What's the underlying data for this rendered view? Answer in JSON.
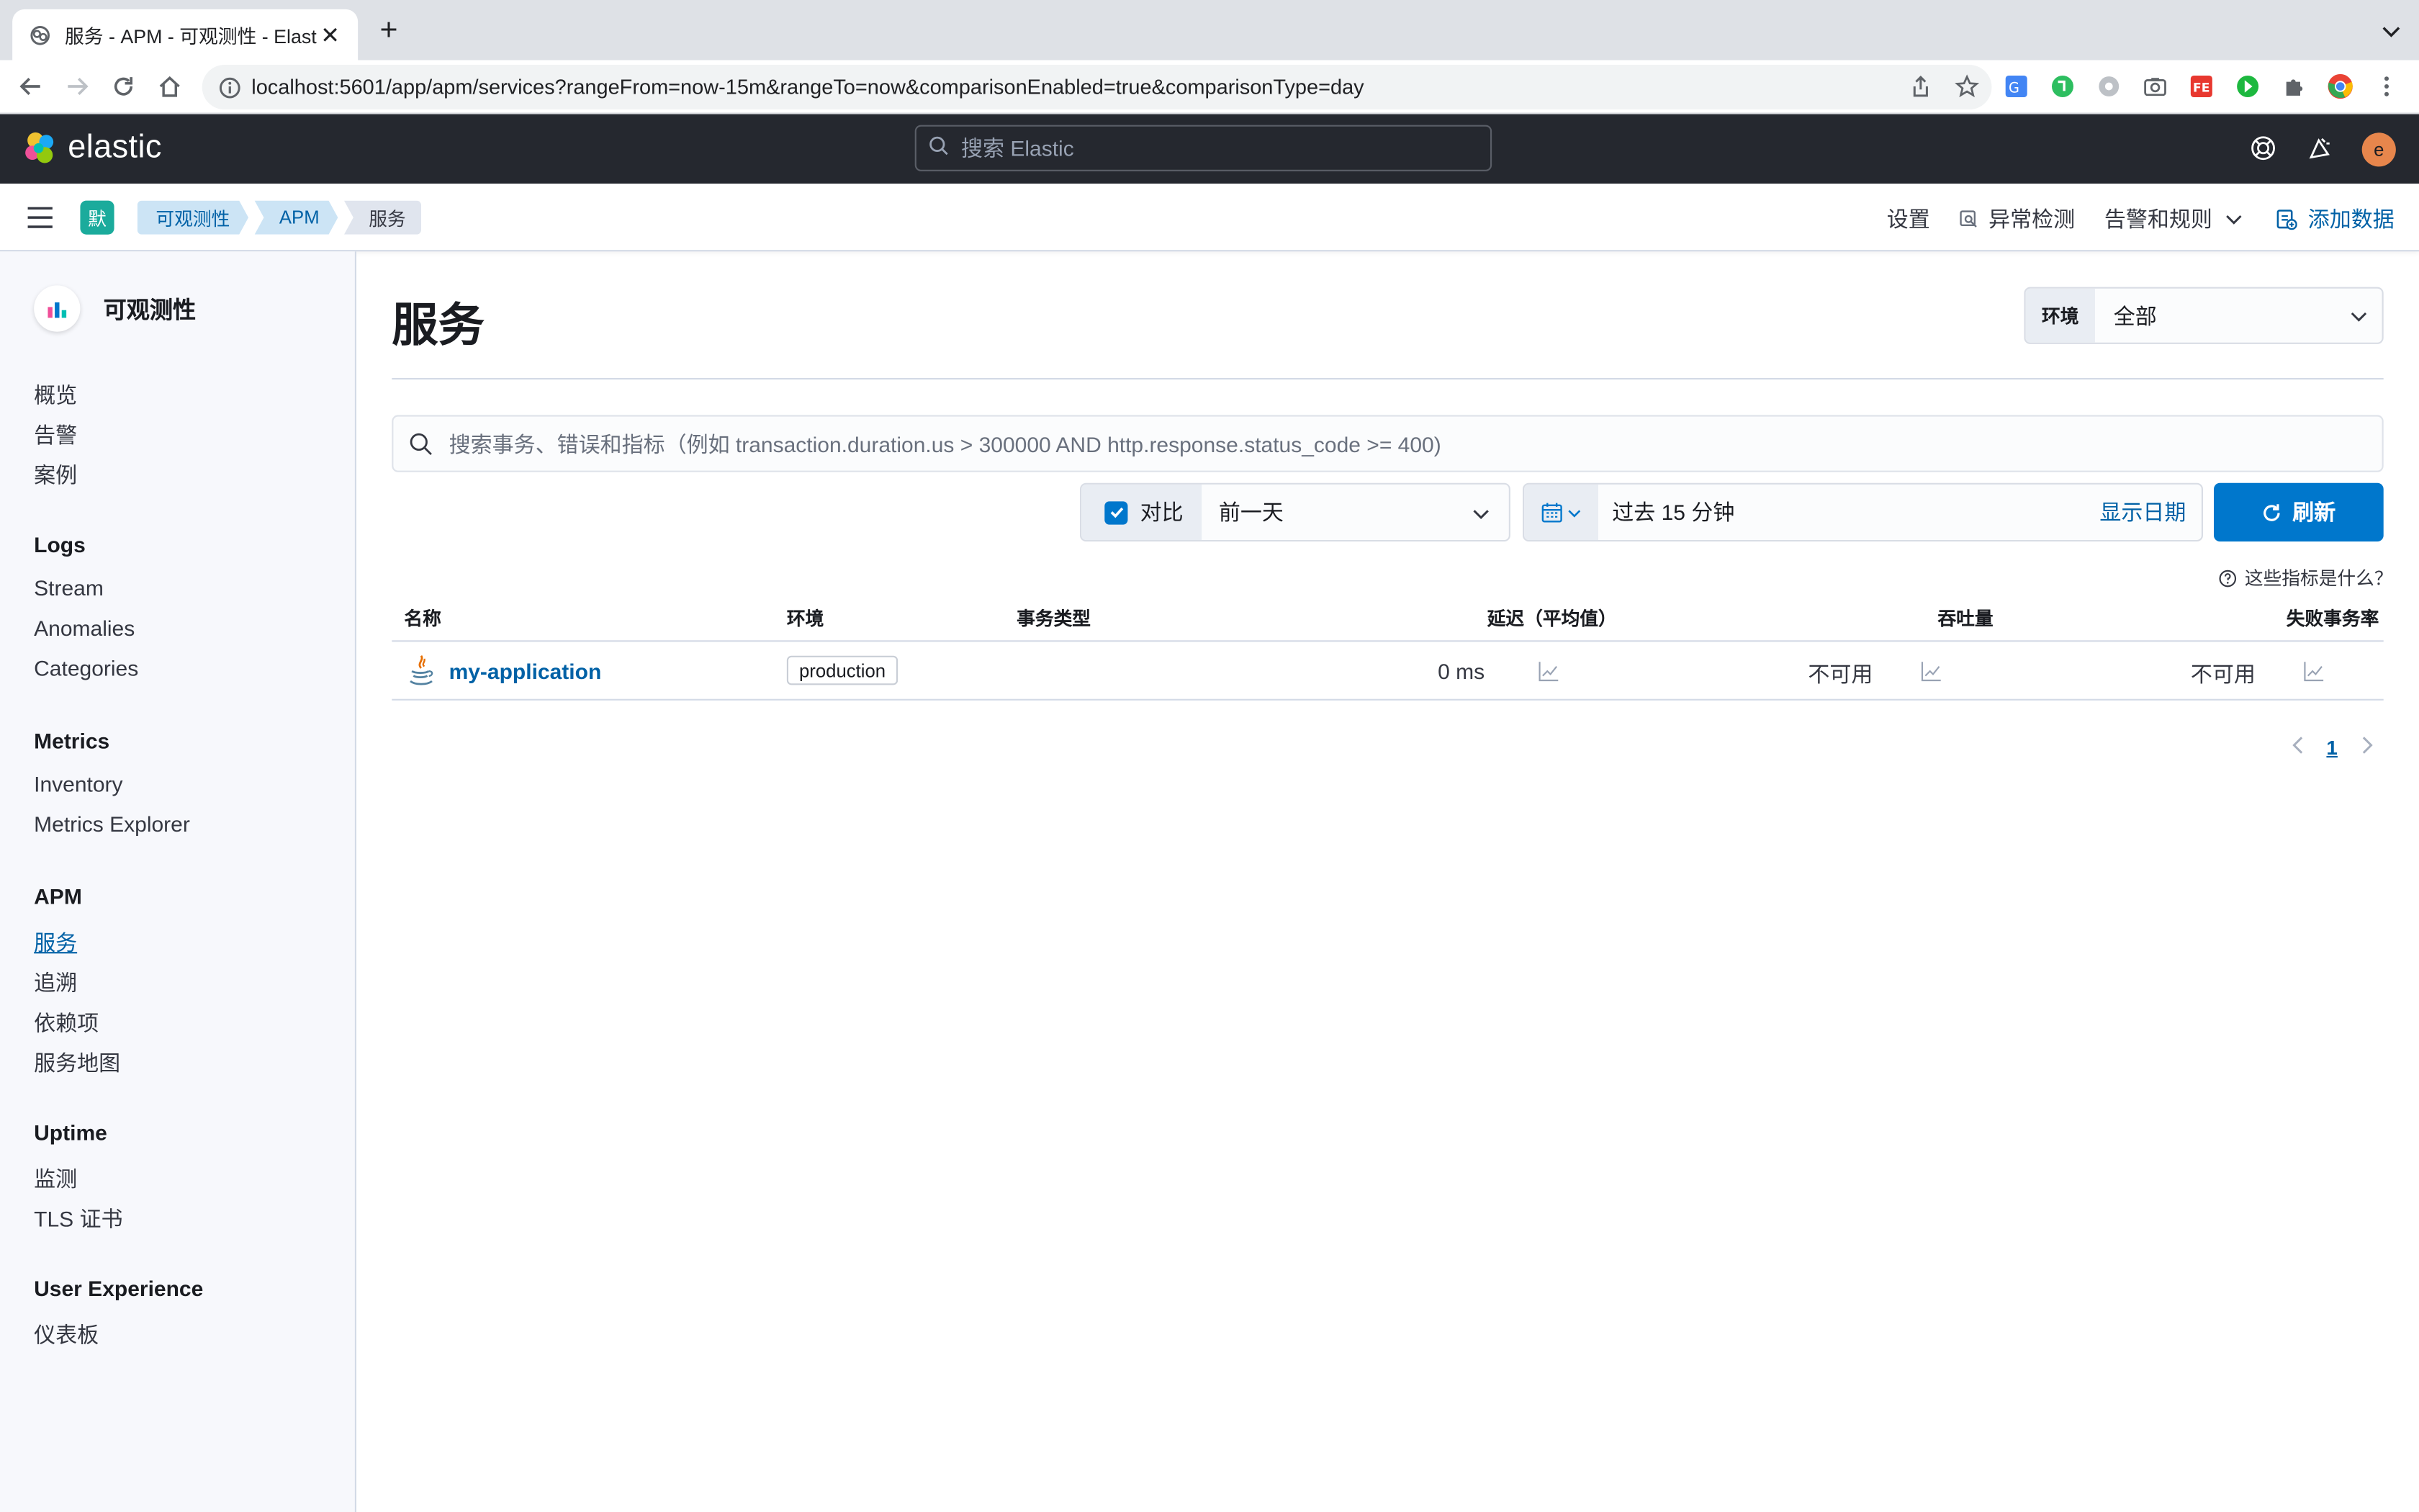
{
  "browser": {
    "tab_title": "服务 - APM - 可观测性 - Elastic",
    "url": "localhost:5601/app/apm/services?rangeFrom=now-15m&rangeTo=now&comparisonEnabled=true&comparisonType=day"
  },
  "header": {
    "logo_text": "elastic",
    "search_placeholder": "搜索 Elastic",
    "avatar_initial": "e"
  },
  "breadcrumbs": {
    "space_badge": "默",
    "items": [
      "可观测性",
      "APM",
      "服务"
    ]
  },
  "topnav": {
    "settings": "设置",
    "anomaly": "异常检测",
    "alerts": "告警和规则",
    "add_data": "添加数据"
  },
  "sidebar": {
    "title": "可观测性",
    "top_items": [
      "概览",
      "告警",
      "案例"
    ],
    "logs": {
      "heading": "Logs",
      "items": [
        "Stream",
        "Anomalies",
        "Categories"
      ]
    },
    "metrics": {
      "heading": "Metrics",
      "items": [
        "Inventory",
        "Metrics Explorer"
      ]
    },
    "apm": {
      "heading": "APM",
      "items": [
        "服务",
        "追溯",
        "依赖项",
        "服务地图"
      ],
      "active": "服务"
    },
    "uptime": {
      "heading": "Uptime",
      "items": [
        "监测",
        "TLS 证书"
      ]
    },
    "ux": {
      "heading": "User Experience",
      "items": [
        "仪表板"
      ]
    }
  },
  "page": {
    "title": "服务",
    "environment_label": "环境",
    "environment_value": "全部",
    "kql_placeholder": "搜索事务、错误和指标（例如 transaction.duration.us > 300000 AND http.response.status_code >= 400)",
    "compare_label": "对比",
    "compare_value": "前一天",
    "date_value": "过去 15 分钟",
    "show_dates": "显示日期",
    "refresh": "刷新",
    "what_are_metrics": "这些指标是什么？"
  },
  "table": {
    "columns": [
      "名称",
      "环境",
      "事务类型",
      "延迟（平均值）",
      "吞吐量",
      "失败事务率"
    ],
    "rows": [
      {
        "name": "my-application",
        "environment": "production",
        "transaction_type": "",
        "latency": "0 ms",
        "throughput": "不可用",
        "failed_rate": "不可用"
      }
    ]
  },
  "pagination": {
    "current": "1"
  },
  "colors": {
    "header_bg": "#25282f",
    "primary": "#0077cc",
    "link": "#0061a6",
    "space_badge": "#1bab9c",
    "avatar": "#e7864c"
  }
}
